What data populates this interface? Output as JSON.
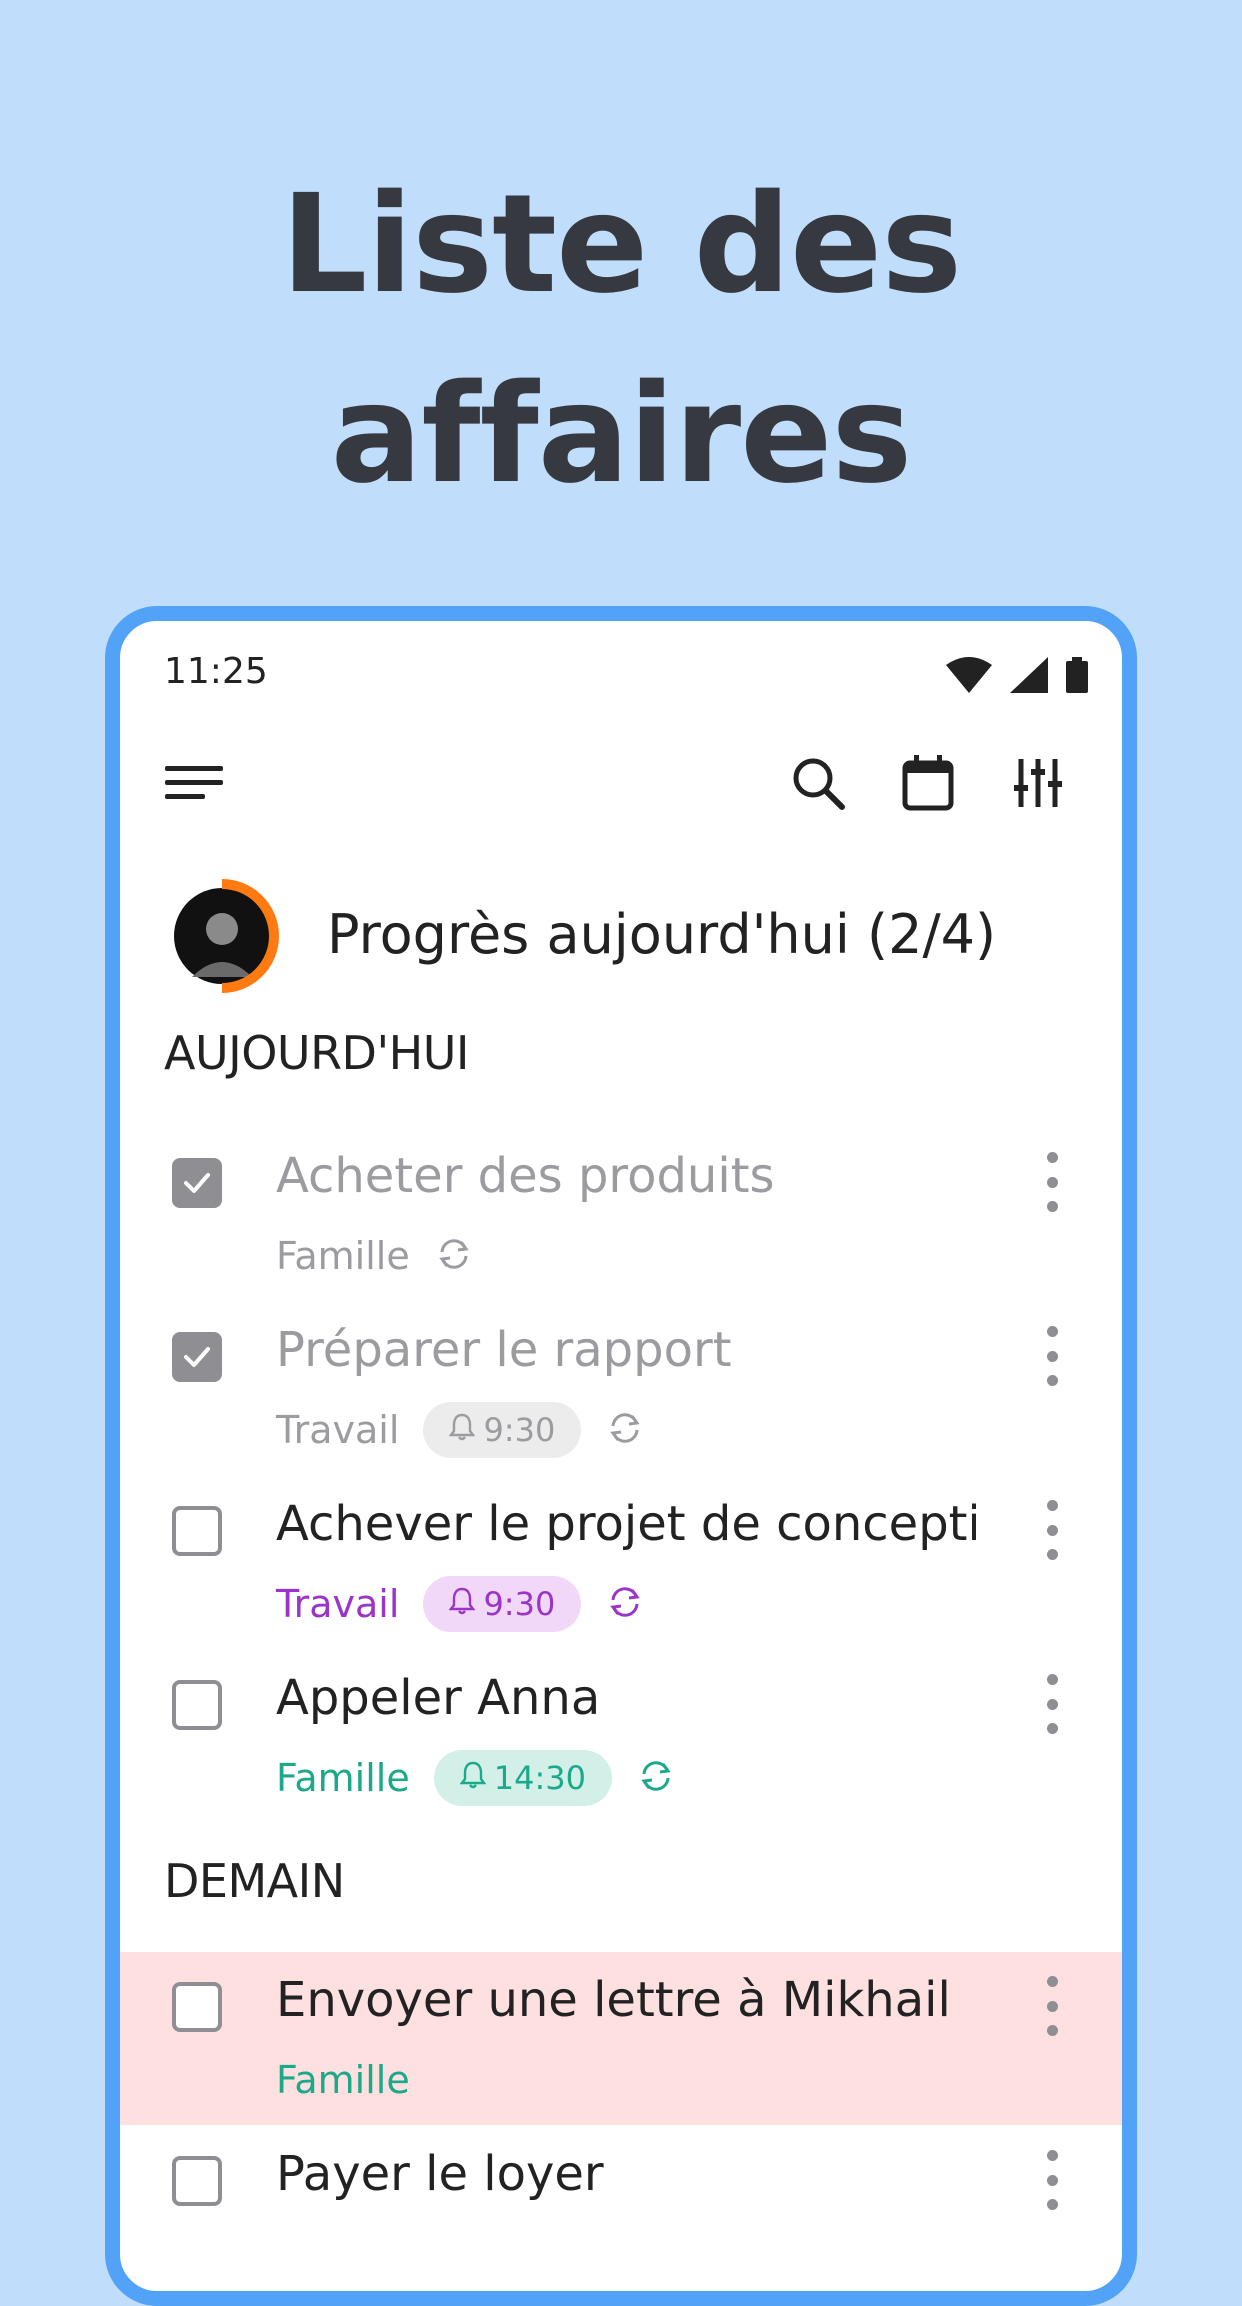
{
  "headline": {
    "line1": "Liste des",
    "line2": "affaires"
  },
  "status_bar": {
    "time": "11:25",
    "icons": [
      "wifi-icon",
      "signal-icon",
      "battery-icon"
    ]
  },
  "toolbar": {
    "icons": [
      "menu-icon",
      "search-icon",
      "calendar-icon",
      "filter-sliders-icon"
    ]
  },
  "progress": {
    "label": "Progrès aujourd'hui (2/4)",
    "done": 2,
    "total": 4,
    "ring_color": "#ff7a10"
  },
  "sections": {
    "today": {
      "title": "AUJOURD'HUI",
      "tasks": [
        {
          "title": "Acheter des produits",
          "category": "Famille",
          "reminder": "",
          "checked": true,
          "repeat": true
        },
        {
          "title": "Préparer le rapport",
          "category": "Travail",
          "reminder": "9:30",
          "checked": true,
          "repeat": true
        },
        {
          "title": "Achever le projet de concepti...",
          "category": "Travail",
          "reminder": "9:30",
          "checked": false,
          "repeat": true
        },
        {
          "title": "Appeler Anna",
          "category": "Famille",
          "reminder": "14:30",
          "checked": false,
          "repeat": true
        }
      ]
    },
    "tomorrow": {
      "title": "DEMAIN",
      "tasks": [
        {
          "title": "Envoyer une lettre à Mikhail",
          "category": "Famille",
          "reminder": "",
          "checked": false,
          "repeat": false
        },
        {
          "title": "Payer le loyer",
          "category": "",
          "reminder": "",
          "checked": false,
          "repeat": false
        }
      ]
    }
  },
  "colors": {
    "background": "#c0ddfb",
    "frame": "#52a3f8",
    "done_gray": "#9b9ba0",
    "travail": "#9b35c8",
    "travail_badge": "#f1d7f8",
    "famille": "#1ba98a",
    "famille_badge": "#d3f0e8",
    "highlight_row": "#fee0e1"
  }
}
